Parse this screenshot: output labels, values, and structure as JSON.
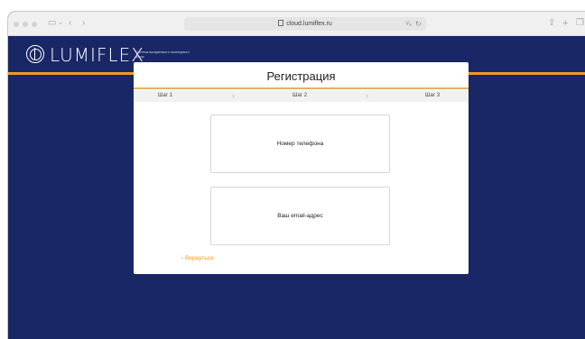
{
  "browser": {
    "url": "cloud.lumiflex.ru",
    "icons": {
      "sidebar": "sidebar-icon",
      "back": "chevron-left-icon",
      "forward": "chevron-right-icon",
      "translate": "translate-icon",
      "reload": "reload-icon",
      "share": "share-icon",
      "new_tab": "plus-icon",
      "tabs": "tabs-icon"
    }
  },
  "header": {
    "logo_text": "LUMIFLEX",
    "tagline": "Система когерентного заметорного зонда"
  },
  "card": {
    "title": "Регистрация",
    "steps": [
      "Шаг 1",
      "Шаг 2",
      "Шаг 3"
    ],
    "options": [
      {
        "label": "Номер телефона"
      },
      {
        "label": "Ваш email-адрес"
      }
    ],
    "back_label": "‹ Вернуться"
  },
  "colors": {
    "background": "#1a2766",
    "accent": "#f39a22",
    "card": "#ffffff"
  }
}
